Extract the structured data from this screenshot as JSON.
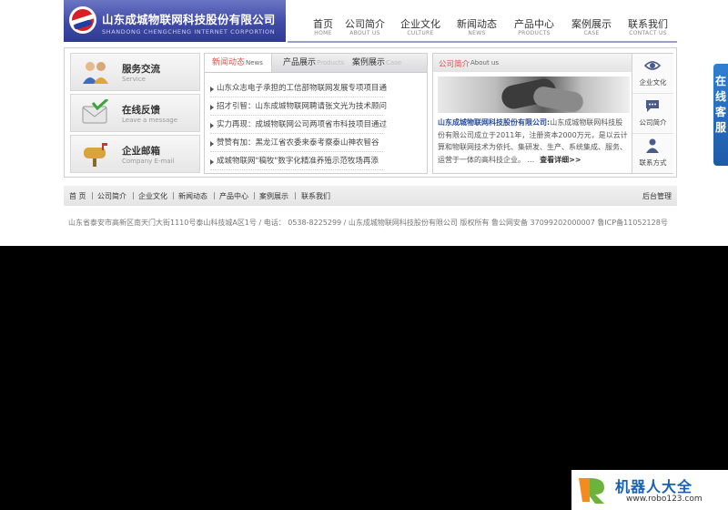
{
  "header": {
    "logo_cn": "山东成城物联网科技股份有限公司",
    "logo_en": "SHANDONG CHENGCHENG INTERNET CORPORTION",
    "nav": [
      {
        "cn": "首页",
        "en": "HOME"
      },
      {
        "cn": "公司简介",
        "en": "ABOUT US"
      },
      {
        "cn": "企业文化",
        "en": "CULTURE"
      },
      {
        "cn": "新闻动态",
        "en": "NEWS"
      },
      {
        "cn": "产品中心",
        "en": "PRODUCTS"
      },
      {
        "cn": "案例展示",
        "en": "CASE"
      },
      {
        "cn": "联系我们",
        "en": "CONTACT US"
      }
    ]
  },
  "services": [
    {
      "cn": "服务交流",
      "en": "Service",
      "icon": "people-icon"
    },
    {
      "cn": "在线反馈",
      "en": "Leave a message",
      "icon": "message-check-icon"
    },
    {
      "cn": "企业邮箱",
      "en": "Company E-mail",
      "icon": "mailbox-icon"
    }
  ],
  "news": {
    "tabs": [
      {
        "cn": "新闻动态",
        "en": "News"
      },
      {
        "cn": "产品展示",
        "en": "Products"
      },
      {
        "cn": "案例展示",
        "en": "Case"
      }
    ],
    "items": [
      "山东众志电子承担的工信部物联网发展专项项目通",
      "招才引智：山东成城物联网聘请张文光为技术顾问",
      "实力再现：成城物联网公司两项省市科技项目通过",
      "赞赞有加：黑龙江省农委来泰考察泰山神农智谷",
      "成城物联网\"稿牧\"数字化精准养殖示范牧场再添"
    ]
  },
  "about": {
    "title_cn": "公司简介",
    "title_en": "About us",
    "lead": "山东成城物联网科技股份有限公司:",
    "body": "山东成城物联网科技股份有限公司成立于2011年，注册资本2000万元，是以云计算和物联网技术为依托、集研发、生产、系统集成、服务、运营于一体的高科技企业。 ...",
    "more": "查看详细>>",
    "side": [
      "企业文化",
      "公司简介",
      "联系方式"
    ]
  },
  "footer": {
    "links": [
      "首 页",
      "公司简介",
      "企业文化",
      "新闻动态",
      "产品中心",
      "案例展示",
      "联系我们"
    ],
    "admin": "后台管理",
    "copyright": "山东省泰安市高新区南天门大街1110号泰山科技城A区1号 / 电话： 0538-8225299 / 山东成城物联网科技股份有限公司 版权所有   鲁公网安备 37099202000007   鲁ICP备11052128号"
  },
  "float_tab": "在线客服",
  "watermark": {
    "cn": "机器人大全",
    "url": "www.robo123.com"
  },
  "colors": {
    "brand": "#3f4aa6",
    "accent": "#d9534f",
    "link": "#2a4c9c"
  }
}
